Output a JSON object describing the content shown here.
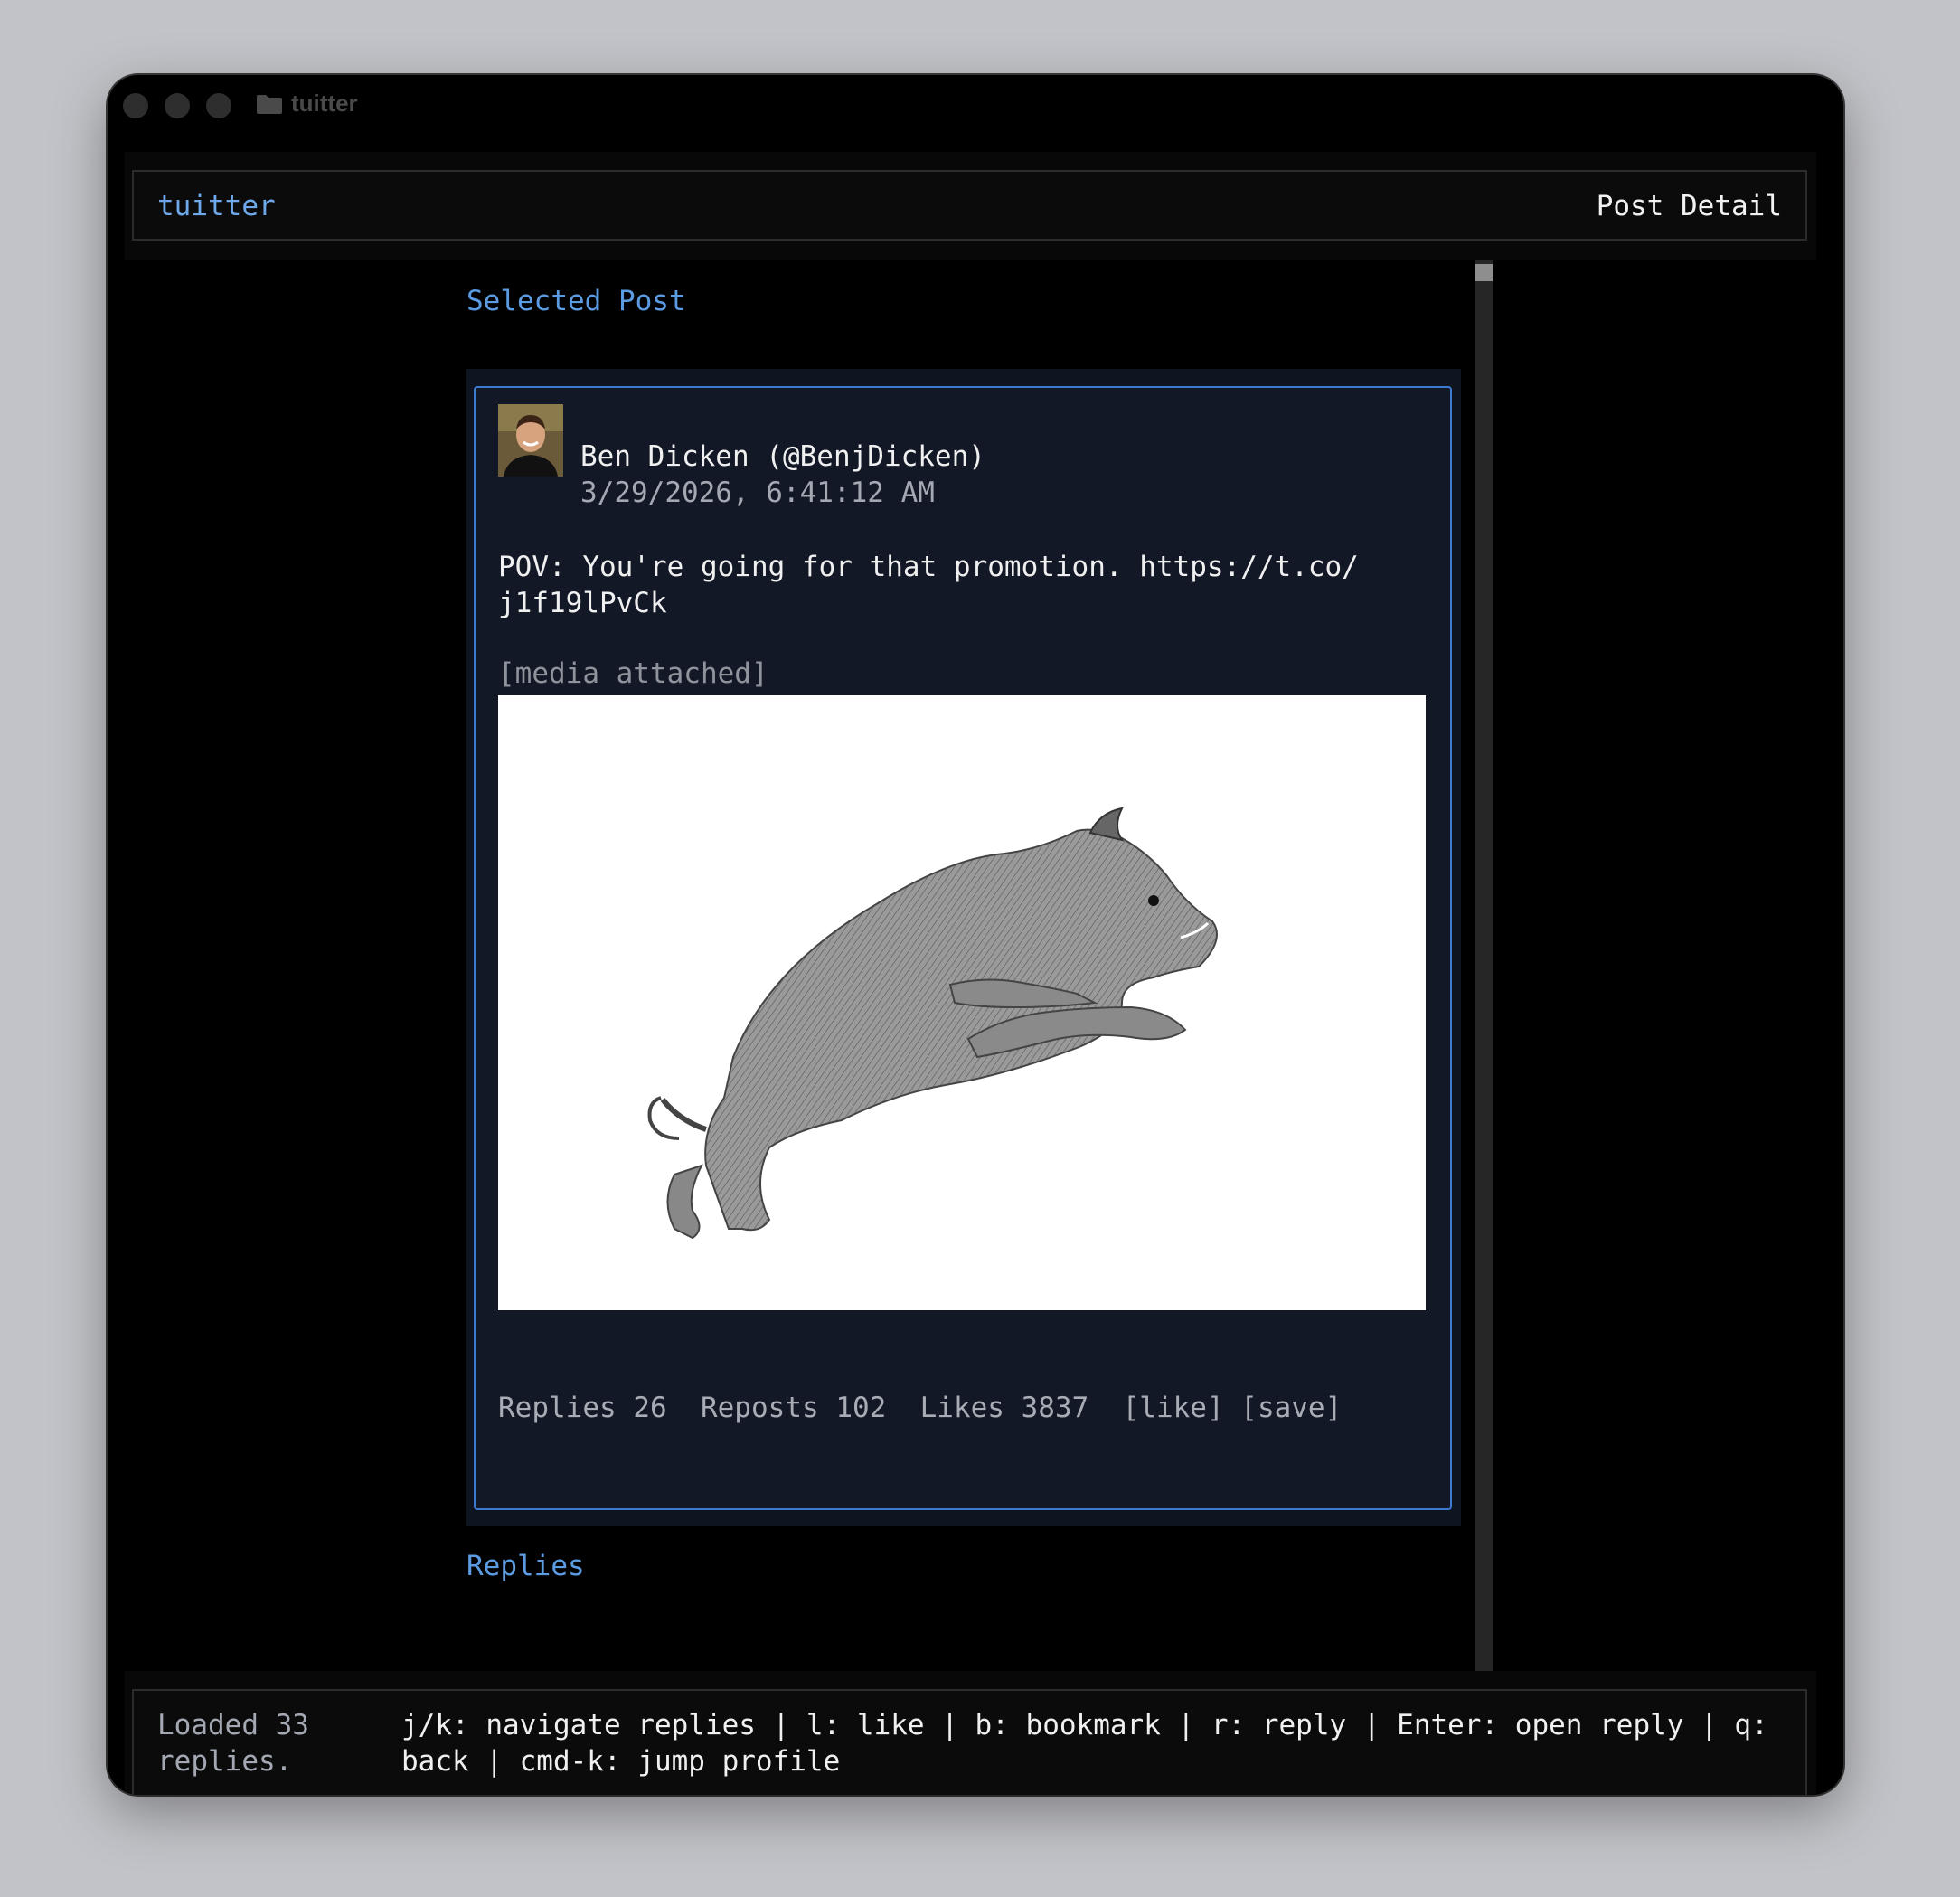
{
  "window": {
    "title": "tuitter"
  },
  "header": {
    "brand": "tuitter",
    "page": "Post Detail"
  },
  "selected_section": {
    "label": "Selected Post"
  },
  "post": {
    "author": "Ben Dicken (@BenjDicken)",
    "timestamp": "3/29/2026, 6:41:12 AM",
    "text": "POV: You're going for that promotion. https://t.co/\nj1f19lPvCk",
    "media_note": "[media attached]",
    "media_alt": "boar-illustration",
    "stats": {
      "replies_label": "Replies",
      "replies": "26",
      "reposts_label": "Reposts",
      "reposts": "102",
      "likes_label": "Likes",
      "likes": "3837",
      "like_action": "[like]",
      "save_action": "[save]"
    }
  },
  "replies_section": {
    "label": "Replies"
  },
  "footer": {
    "status": "Loaded 33\nreplies.",
    "help": "j/k: navigate replies | l: like | b: bookmark | r: reply | Enter: open reply | q:\nback | cmd-k: jump profile"
  },
  "colors": {
    "accent": "#5b9be2",
    "card_border": "#3b7bd1",
    "card_bg": "#121826"
  }
}
